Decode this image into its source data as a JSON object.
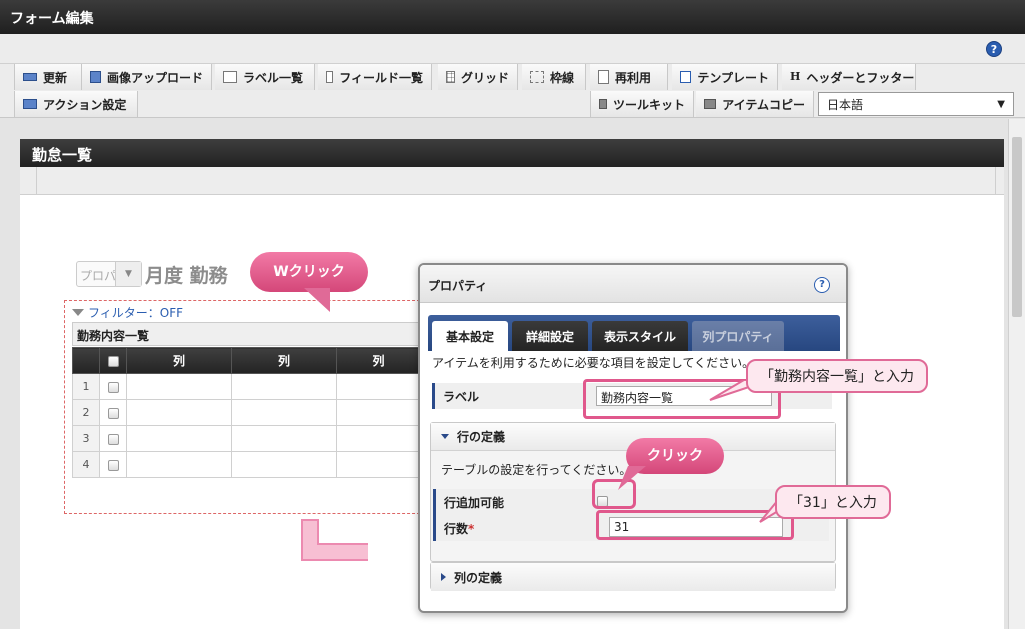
{
  "window": {
    "title": "フォーム編集"
  },
  "help": {
    "glyph": "?"
  },
  "toolbar": {
    "row1": [
      {
        "label": "更新",
        "icon": "refresh-icon"
      },
      {
        "label": "画像アップロード",
        "icon": "image-upload-icon"
      },
      {
        "label": "ラベル一覧",
        "icon": "label-list-icon"
      },
      {
        "label": "フィールド一覧",
        "icon": "field-list-icon"
      },
      {
        "label": "グリッド",
        "icon": "grid-icon"
      },
      {
        "label": "枠線",
        "icon": "border-icon"
      },
      {
        "label": "再利用",
        "icon": "reuse-icon"
      },
      {
        "label": "テンプレート",
        "icon": "template-icon"
      },
      {
        "label": "ヘッダーとフッター",
        "icon": "header-footer-icon"
      }
    ],
    "action": {
      "label": "アクション設定",
      "icon": "action-icon"
    },
    "toolkit": {
      "label": "ツールキット",
      "icon": "toolkit-icon"
    },
    "item_copy": {
      "label": "アイテムコピー",
      "icon": "toolkit-icon"
    },
    "language": {
      "value": "日本語",
      "arrow": "▼"
    }
  },
  "form": {
    "title": "勤怠一覧",
    "select_stub": "プロパ",
    "select_arrow": "▼",
    "heading_partial": "月度 勤務",
    "filter": "フィルター：OFF",
    "table_title": "勤務内容一覧",
    "columns": [
      "列",
      "列",
      "列"
    ],
    "rows": [
      "1",
      "2",
      "3",
      "4"
    ]
  },
  "dialog": {
    "title": "プロパティ",
    "help": "?",
    "tabs": [
      "基本設定",
      "詳細設定",
      "表示スタイル",
      "列プロパティ"
    ],
    "description": "アイテムを利用するために必要な項目を設定してください。",
    "label_field": {
      "label": "ラベル",
      "value": "勤務内容一覧"
    },
    "row_section": {
      "title": "行の定義",
      "description": "テーブルの設定を行ってください。",
      "addable_label": "行追加可能",
      "rows_label": "行数",
      "required_mark": "*",
      "rows_value": "31"
    },
    "column_section": {
      "title": "列の定義"
    }
  },
  "annotations": {
    "double_click": "Wクリック",
    "click": "クリック",
    "label_note": "「勤務内容一覧」と入力",
    "rows_note": "「31」と入力",
    "accent_color": "#e0588c"
  }
}
